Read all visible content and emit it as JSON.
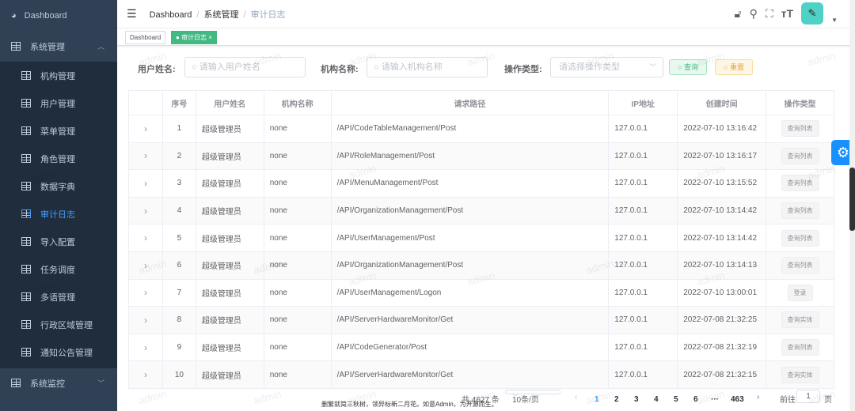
{
  "sidebar": {
    "top": [
      {
        "label": "Dashboard"
      },
      {
        "label": "系统管理"
      }
    ],
    "items": [
      {
        "label": "机构管理"
      },
      {
        "label": "用户管理"
      },
      {
        "label": "菜单管理"
      },
      {
        "label": "角色管理"
      },
      {
        "label": "数据字典"
      },
      {
        "label": "审计日志",
        "active": true
      },
      {
        "label": "导入配置"
      },
      {
        "label": "任务调度"
      },
      {
        "label": "多语管理"
      },
      {
        "label": "行政区域管理"
      },
      {
        "label": "通知公告管理"
      }
    ],
    "bottom": {
      "label": "系统监控"
    }
  },
  "breadcrumb": [
    "Dashboard",
    "系统管理",
    "审计日志"
  ],
  "tags": [
    {
      "label": "Dashboard"
    },
    {
      "label": "审计日志",
      "close": "×"
    }
  ],
  "filter": {
    "user_label": "用户姓名:",
    "user_placeholder": "请输入用户姓名",
    "org_label": "机构名称:",
    "org_placeholder": "请输入机构名称",
    "type_label": "操作类型:",
    "type_placeholder": "请选择操作类型",
    "search": "查询",
    "reset": "重置"
  },
  "table": {
    "headers": [
      "",
      "序号",
      "用户姓名",
      "机构名称",
      "请求路径",
      "IP地址",
      "创建时间",
      "操作类型"
    ],
    "rows": [
      [
        "1",
        "超级管理员",
        "none",
        "/API/CodeTableManagement/Post",
        "127.0.0.1",
        "2022-07-10 13:16:42",
        "查询列表"
      ],
      [
        "2",
        "超级管理员",
        "none",
        "/API/RoleManagement/Post",
        "127.0.0.1",
        "2022-07-10 13:16:17",
        "查询列表"
      ],
      [
        "3",
        "超级管理员",
        "none",
        "/API/MenuManagement/Post",
        "127.0.0.1",
        "2022-07-10 13:15:52",
        "查询列表"
      ],
      [
        "4",
        "超级管理员",
        "none",
        "/API/OrganizationManagement/Post",
        "127.0.0.1",
        "2022-07-10 13:14:42",
        "查询列表"
      ],
      [
        "5",
        "超级管理员",
        "none",
        "/API/UserManagement/Post",
        "127.0.0.1",
        "2022-07-10 13:14:42",
        "查询列表"
      ],
      [
        "6",
        "超级管理员",
        "none",
        "/API/OrganizationManagement/Post",
        "127.0.0.1",
        "2022-07-10 13:14:13",
        "查询列表"
      ],
      [
        "7",
        "超级管理员",
        "none",
        "/API/UserManagement/Logon",
        "127.0.0.1",
        "2022-07-10 13:00:01",
        "登录"
      ],
      [
        "8",
        "超级管理员",
        "none",
        "/API/ServerHardwareMonitor/Get",
        "127.0.0.1",
        "2022-07-08 21:32:25",
        "查询实体"
      ],
      [
        "9",
        "超级管理员",
        "none",
        "/API/CodeGenerator/Post",
        "127.0.0.1",
        "2022-07-08 21:32:19",
        "查询列表"
      ],
      [
        "10",
        "超级管理员",
        "none",
        "/API/ServerHardwareMonitor/Get",
        "127.0.0.1",
        "2022-07-08 21:32:15",
        "查询实体"
      ]
    ]
  },
  "pagination": {
    "total": "共 4627 条",
    "page_size": "10条/页",
    "pages": [
      "1",
      "2",
      "3",
      "4",
      "5",
      "6",
      "···",
      "463"
    ],
    "current": "1",
    "goto_label": "前往",
    "goto_value": "1",
    "goto_suffix": "页"
  },
  "footer": "删繁就简三秋树，领异标新二月花。如意Admin，为开源而生。",
  "watermark": "admin",
  "colors": {
    "sidebar": "#304156",
    "submenu": "#1f2d3d",
    "active": "#409eff",
    "tag_active": "#42b983"
  }
}
